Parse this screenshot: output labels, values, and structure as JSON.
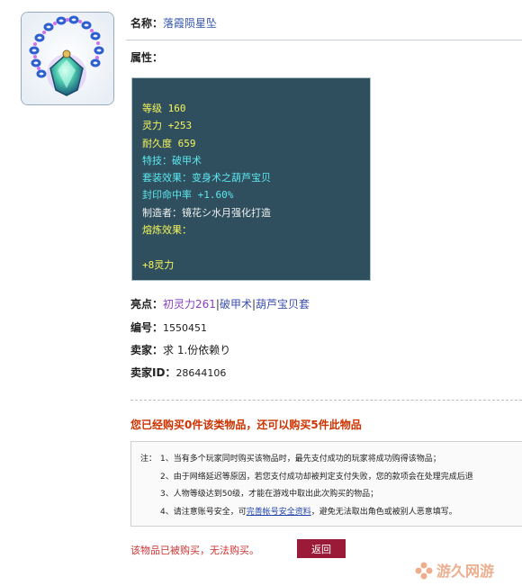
{
  "item": {
    "name_label": "名称：",
    "name_value": "落霞陨星坠",
    "attr_label": "属性："
  },
  "stats": [
    {
      "text": "等级 160",
      "color": "yellow"
    },
    {
      "text": "灵力 +253",
      "color": "yellow"
    },
    {
      "text": "耐久度 659",
      "color": "yellow"
    },
    {
      "text": "特技：破甲术",
      "color": "aqua"
    },
    {
      "text": "套装效果：变身术之葫芦宝贝",
      "color": "aqua"
    },
    {
      "text": "封印命中率 +1.60%",
      "color": "aqua"
    },
    {
      "text": "制造者：镜花シ水月强化打造",
      "color": "white"
    },
    {
      "text": "熔炼效果：",
      "color": "yellow"
    },
    {
      "text": "",
      "color": "yellow"
    },
    {
      "text": "+8灵力",
      "color": "yellow"
    }
  ],
  "highlights": {
    "label": "亮点：",
    "items": [
      "初灵力261",
      "破甲术",
      "葫芦宝贝套"
    ],
    "separator": "|"
  },
  "serial": {
    "label": "编号：",
    "value": "1550451"
  },
  "seller": {
    "label": "卖家：",
    "value": "求 1.份依赖り"
  },
  "seller_id": {
    "label": "卖家ID：",
    "value": "28644106"
  },
  "purchase_message": "您已经购买0件该类物品，还可以购买5件此物品",
  "notice": {
    "prefix": "注：",
    "lines": [
      "1、当有多个玩家同时购买该物品时，最先支付成功的玩家将成功购得该物品；",
      "2、由于网络延迟等原因，若您支付成功却被判定支付失败，您的款项会在处理完成后退",
      "3、人物等级达到50级，才能在游戏中取出此次购买的物品；"
    ],
    "line4_before": "4、请注意账号安全，可",
    "line4_link": "完善帐号安全资料",
    "line4_after": "，避免无法取出角色或被别人恶意填写。"
  },
  "cannot_buy": "该物品已被购买，无法购买。",
  "back_button": "返回",
  "watermark": "游久网游",
  "colors": {
    "stat_bg": "#2f4f5f",
    "yellow": "#f6f65a",
    "aqua": "#5de8ee",
    "white": "#f0f0f0",
    "accent_red": "#cc3300",
    "button": "#9b1a38"
  }
}
